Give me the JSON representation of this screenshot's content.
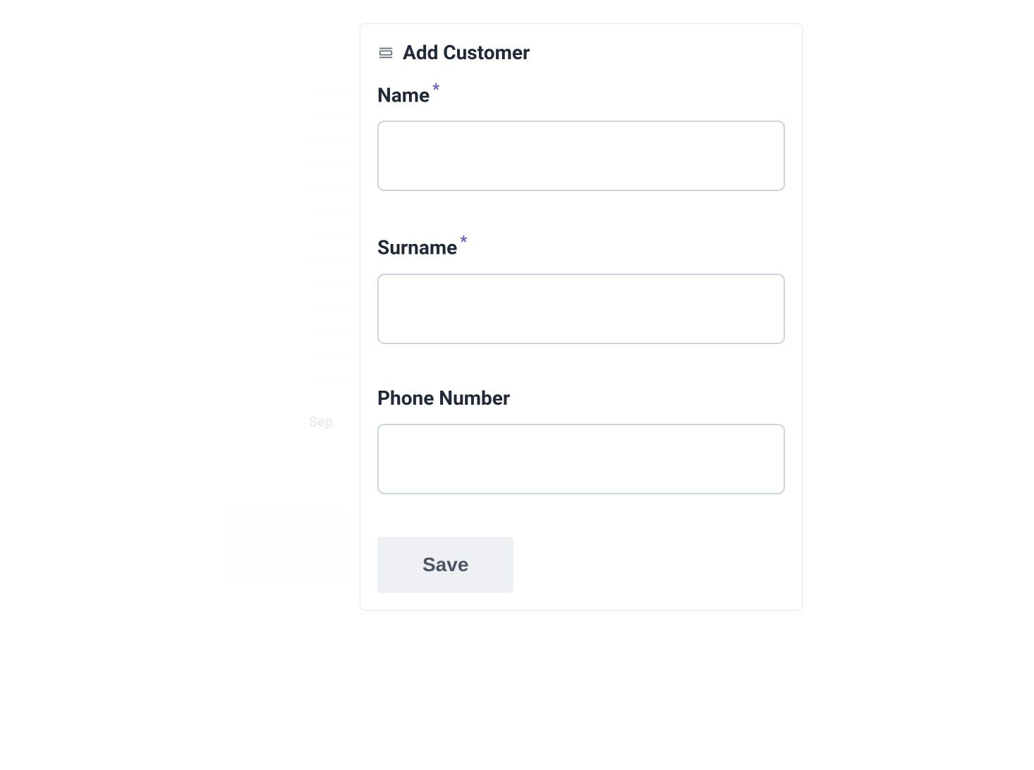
{
  "background": {
    "month_label": "Sep"
  },
  "drawer": {
    "title": "Add Customer",
    "fields": {
      "name": {
        "label": "Name",
        "required": true,
        "value": ""
      },
      "surname": {
        "label": "Surname",
        "required": true,
        "value": ""
      },
      "phone": {
        "label": "Phone Number",
        "required": false,
        "value": ""
      }
    },
    "save_button_label": "Save",
    "required_indicator": "*"
  }
}
